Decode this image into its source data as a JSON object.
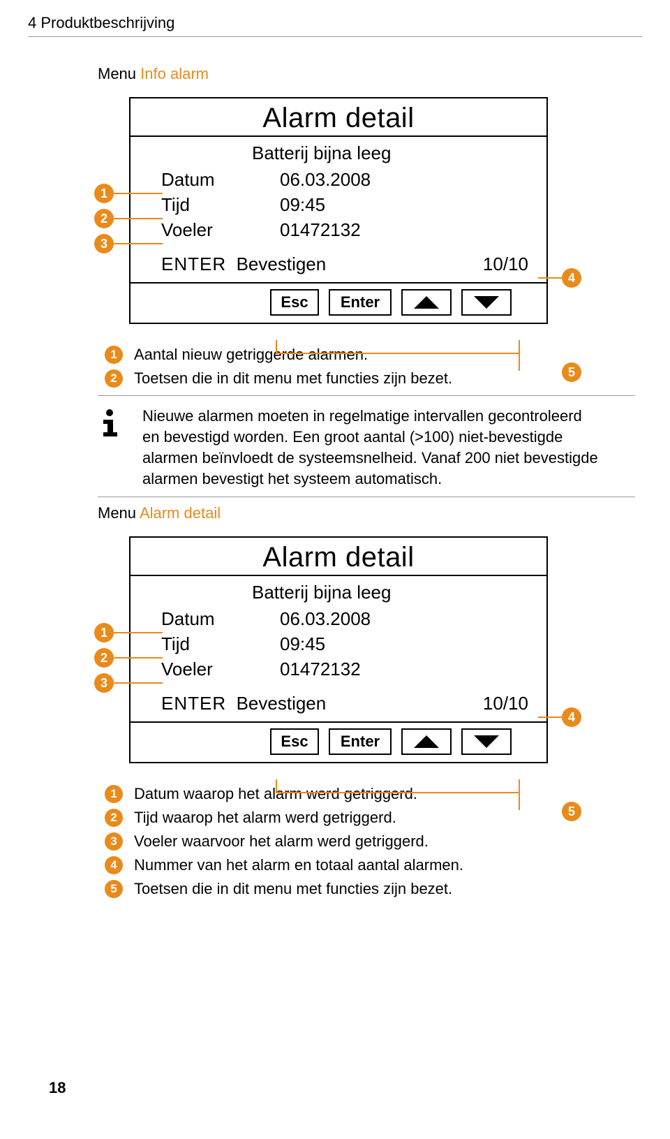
{
  "chapter": "4 Produktbeschrijving",
  "page_number": "18",
  "menu1": {
    "prefix": "Menu ",
    "name": "Info alarm"
  },
  "menu2": {
    "prefix": "Menu ",
    "name": "Alarm detail"
  },
  "shot": {
    "title": "Alarm detail",
    "subtitle": "Batterij bijna leeg",
    "rows": [
      {
        "label": "Datum",
        "value": "06.03.2008"
      },
      {
        "label": "Tijd",
        "value": "09:45"
      },
      {
        "label": "Voeler",
        "value": "01472132"
      }
    ],
    "enter_word": "ENTER",
    "enter_hint": "Bevestigen",
    "count": "10/10",
    "buttons": {
      "esc": "Esc",
      "enter": "Enter"
    }
  },
  "callouts": {
    "c1": "1",
    "c2": "2",
    "c3": "3",
    "c4": "4",
    "c5": "5"
  },
  "legend_a": [
    {
      "n": "1",
      "text": "Aantal nieuw getriggerde alarmen."
    },
    {
      "n": "2",
      "text": "Toetsen die in dit menu met functies zijn bezet."
    }
  ],
  "info_text": "Nieuwe alarmen moeten in regelmatige intervallen gecontroleerd en bevestigd worden. Een groot aantal (>100) niet-bevestigde alarmen beïnvloedt de systeemsnelheid. Vanaf 200 niet bevestigde alarmen bevestigt het systeem automatisch.",
  "legend_b": [
    {
      "n": "1",
      "text": "Datum waarop het alarm werd getriggerd."
    },
    {
      "n": "2",
      "text": "Tijd waarop het alarm werd getriggerd."
    },
    {
      "n": "3",
      "text": "Voeler waarvoor het alarm werd getriggerd."
    },
    {
      "n": "4",
      "text": "Nummer van het alarm en totaal aantal alarmen."
    },
    {
      "n": "5",
      "text": "Toetsen die in dit menu met functies zijn bezet."
    }
  ]
}
